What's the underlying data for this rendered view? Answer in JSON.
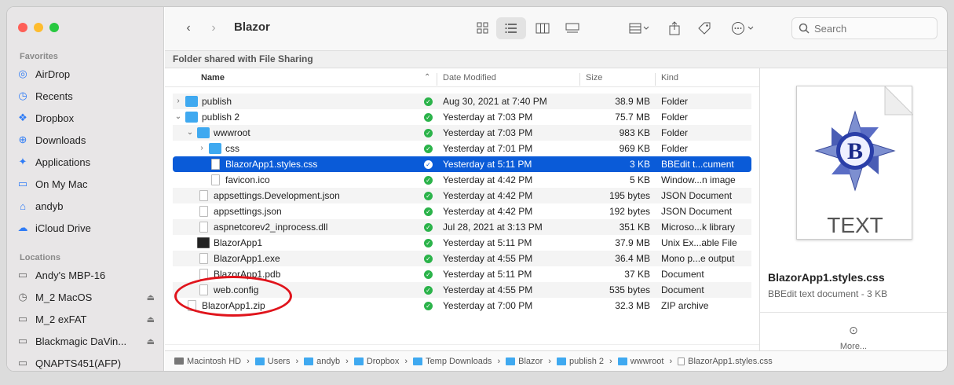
{
  "window": {
    "title": "Blazor",
    "shared_banner": "Folder shared with File Sharing"
  },
  "search": {
    "placeholder": "Search"
  },
  "sidebar": {
    "favorites_title": "Favorites",
    "favorites": [
      {
        "label": "AirDrop",
        "icon": "airdrop-icon"
      },
      {
        "label": "Recents",
        "icon": "clock-icon"
      },
      {
        "label": "Dropbox",
        "icon": "dropbox-icon"
      },
      {
        "label": "Downloads",
        "icon": "download-icon"
      },
      {
        "label": "Applications",
        "icon": "applications-icon"
      },
      {
        "label": "On My Mac",
        "icon": "folder-icon"
      },
      {
        "label": "andyb",
        "icon": "home-icon"
      },
      {
        "label": "iCloud Drive",
        "icon": "cloud-icon"
      }
    ],
    "locations_title": "Locations",
    "locations": [
      {
        "label": "Andy's MBP-16",
        "icon": "laptop-icon"
      },
      {
        "label": "M_2 MacOS",
        "icon": "clock-disk-icon"
      },
      {
        "label": "M_2 exFAT",
        "icon": "disk-icon"
      },
      {
        "label": "Blackmagic DaVin...",
        "icon": "disk-icon"
      },
      {
        "label": "QNAPTS451(AFP)",
        "icon": "display-icon"
      }
    ]
  },
  "columns": {
    "name": "Name",
    "date": "Date Modified",
    "size": "Size",
    "kind": "Kind"
  },
  "files": [
    {
      "name": "publish",
      "date": "Aug 30, 2021 at 7:40 PM",
      "size": "38.9 MB",
      "kind": "Folder",
      "type": "folder",
      "indent": 0,
      "disclosure": "›"
    },
    {
      "name": "publish 2",
      "date": "Yesterday at 7:03 PM",
      "size": "75.7 MB",
      "kind": "Folder",
      "type": "folder",
      "indent": 0,
      "disclosure": "⌄"
    },
    {
      "name": "wwwroot",
      "date": "Yesterday at 7:03 PM",
      "size": "983 KB",
      "kind": "Folder",
      "type": "folder",
      "indent": 1,
      "disclosure": "⌄"
    },
    {
      "name": "css",
      "date": "Yesterday at 7:01 PM",
      "size": "969 KB",
      "kind": "Folder",
      "type": "folder",
      "indent": 2,
      "disclosure": "›"
    },
    {
      "name": "BlazorApp1.styles.css",
      "date": "Yesterday at 5:11 PM",
      "size": "3 KB",
      "kind": "BBEdit t...cument",
      "type": "doc",
      "indent": 2,
      "disclosure": ""
    },
    {
      "name": "favicon.ico",
      "date": "Yesterday at 4:42 PM",
      "size": "5 KB",
      "kind": "Window...n image",
      "type": "doc",
      "indent": 2,
      "disclosure": ""
    },
    {
      "name": "appsettings.Development.json",
      "date": "Yesterday at 4:42 PM",
      "size": "195 bytes",
      "kind": "JSON Document",
      "type": "doc",
      "indent": 1,
      "disclosure": ""
    },
    {
      "name": "appsettings.json",
      "date": "Yesterday at 4:42 PM",
      "size": "192 bytes",
      "kind": "JSON Document",
      "type": "doc",
      "indent": 1,
      "disclosure": ""
    },
    {
      "name": "aspnetcorev2_inprocess.dll",
      "date": "Jul 28, 2021 at 3:13 PM",
      "size": "351 KB",
      "kind": "Microso...k library",
      "type": "doc",
      "indent": 1,
      "disclosure": ""
    },
    {
      "name": "BlazorApp1",
      "date": "Yesterday at 5:11 PM",
      "size": "37.9 MB",
      "kind": "Unix Ex...able File",
      "type": "exec",
      "indent": 1,
      "disclosure": ""
    },
    {
      "name": "BlazorApp1.exe",
      "date": "Yesterday at 4:55 PM",
      "size": "36.4 MB",
      "kind": "Mono p...e output",
      "type": "doc",
      "indent": 1,
      "disclosure": ""
    },
    {
      "name": "BlazorApp1.pdb",
      "date": "Yesterday at 5:11 PM",
      "size": "37 KB",
      "kind": "Document",
      "type": "doc",
      "indent": 1,
      "disclosure": ""
    },
    {
      "name": "web.config",
      "date": "Yesterday at 4:55 PM",
      "size": "535 bytes",
      "kind": "Document",
      "type": "doc",
      "indent": 1,
      "disclosure": ""
    },
    {
      "name": "BlazorApp1.zip",
      "date": "Yesterday at 7:00 PM",
      "size": "32.3 MB",
      "kind": "ZIP archive",
      "type": "doc",
      "indent": 0,
      "disclosure": ""
    }
  ],
  "selected_index": 4,
  "preview": {
    "badge_text": "TEXT",
    "badge_letter": "B",
    "name": "BlazorApp1.styles.css",
    "subtitle": "BBEdit text document - 3 KB",
    "more_label": "More..."
  },
  "pathbar": [
    "Macintosh HD",
    "Users",
    "andyb",
    "Dropbox",
    "Temp Downloads",
    "Blazor",
    "publish 2",
    "wwwroot",
    "BlazorApp1.styles.css"
  ],
  "colors": {
    "accent": "#0a5bd8",
    "folder": "#3fa9f0",
    "ok": "#2bb34a",
    "annotation": "#e0141c"
  }
}
